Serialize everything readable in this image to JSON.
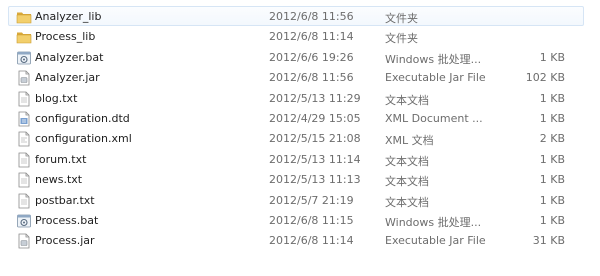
{
  "files": [
    {
      "name": "Analyzer_lib",
      "date": "2012/6/8 11:56",
      "type": "文件夹",
      "size": "",
      "icon": "folder-icon"
    },
    {
      "name": "Process_lib",
      "date": "2012/6/8 11:14",
      "type": "文件夹",
      "size": "",
      "icon": "folder-icon"
    },
    {
      "name": "Analyzer.bat",
      "date": "2012/6/6 19:26",
      "type": "Windows 批处理...",
      "size": "1 KB",
      "icon": "batch-file-icon"
    },
    {
      "name": "Analyzer.jar",
      "date": "2012/6/8 11:56",
      "type": "Executable Jar File",
      "size": "102 KB",
      "icon": "jar-file-icon"
    },
    {
      "name": "blog.txt",
      "date": "2012/5/13 11:29",
      "type": "文本文档",
      "size": "1 KB",
      "icon": "text-file-icon"
    },
    {
      "name": "configuration.dtd",
      "date": "2012/4/29 15:05",
      "type": "XML Document ...",
      "size": "1 KB",
      "icon": "dtd-file-icon"
    },
    {
      "name": "configuration.xml",
      "date": "2012/5/15 21:08",
      "type": "XML 文档",
      "size": "2 KB",
      "icon": "xml-file-icon"
    },
    {
      "name": "forum.txt",
      "date": "2012/5/13 11:14",
      "type": "文本文档",
      "size": "1 KB",
      "icon": "text-file-icon"
    },
    {
      "name": "news.txt",
      "date": "2012/5/13 11:13",
      "type": "文本文档",
      "size": "1 KB",
      "icon": "text-file-icon"
    },
    {
      "name": "postbar.txt",
      "date": "2012/5/7 21:19",
      "type": "文本文档",
      "size": "1 KB",
      "icon": "text-file-icon"
    },
    {
      "name": "Process.bat",
      "date": "2012/6/8 11:15",
      "type": "Windows 批处理...",
      "size": "1 KB",
      "icon": "batch-file-icon"
    },
    {
      "name": "Process.jar",
      "date": "2012/6/8 11:14",
      "type": "Executable Jar File",
      "size": "31 KB",
      "icon": "jar-file-icon"
    }
  ],
  "selected_index": 0,
  "colors": {
    "selection_border": "#d6e5f5",
    "folder": "#e8c25a",
    "meta_text": "#6d6d6d"
  }
}
